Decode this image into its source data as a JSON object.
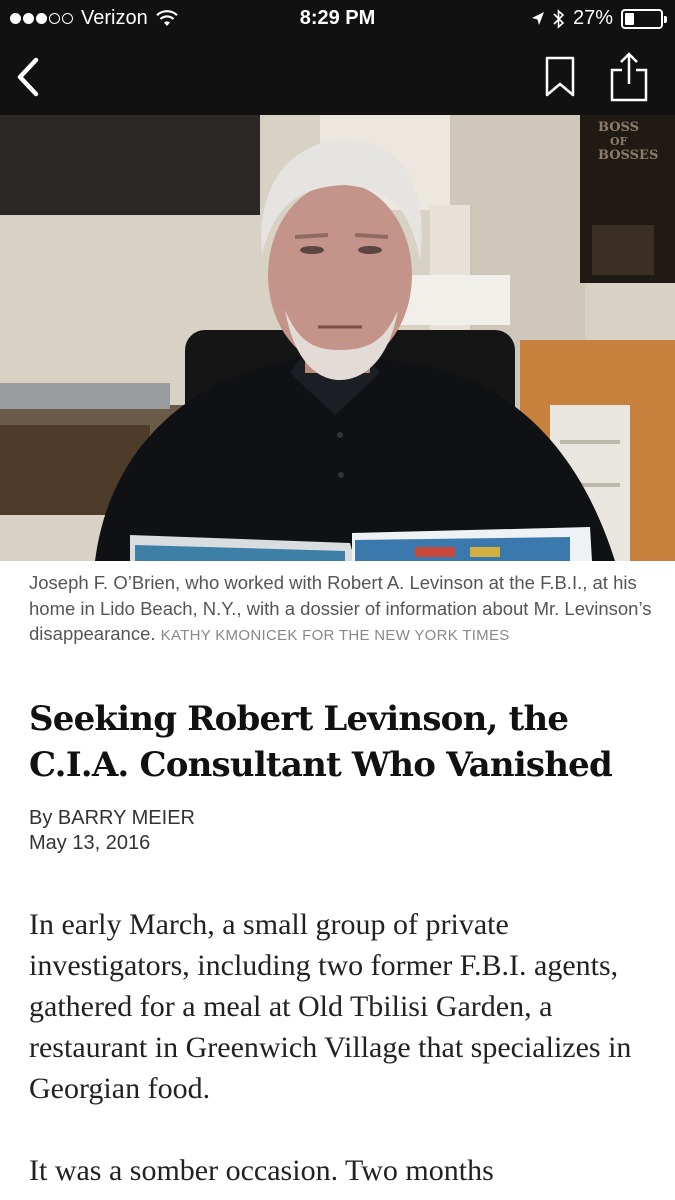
{
  "status_bar": {
    "carrier": "Verizon",
    "time": "8:29 PM",
    "battery_percent": "27%",
    "battery_level": 0.27
  },
  "nav": {
    "back_icon": "chevron-left-icon",
    "bookmark_icon": "bookmark-icon",
    "share_icon": "share-icon"
  },
  "photo": {
    "caption": "Joseph F. O’Brien, who worked with Robert A. Levinson at the F.B.I., at his home in Lido Beach, N.Y., with a dossier of information about Mr. Levinson’s disappearance.",
    "credit": "KATHY KMONICEK FOR THE NEW YORK TIMES",
    "poster_text_1": "BOSS",
    "poster_text_2": "OF",
    "poster_text_3": "BOSSES"
  },
  "article": {
    "headline": "Seeking Robert Levinson, the C.I.A. Consultant Who Vanished",
    "byline": "By BARRY MEIER",
    "date": "May 13, 2016",
    "paragraph_1": "In early March, a small group of private investigators, including two former F.B.I. agents, gathered for a meal at Old Tbilisi Garden, a restaurant in Greenwich Village that specializes in Georgian food.",
    "paragraph_2": "It was a somber occasion. Two months"
  },
  "colors": {
    "bar_background": "#111111",
    "caption_text": "#555555",
    "credit_text": "#888888",
    "headline_text": "#111111"
  }
}
